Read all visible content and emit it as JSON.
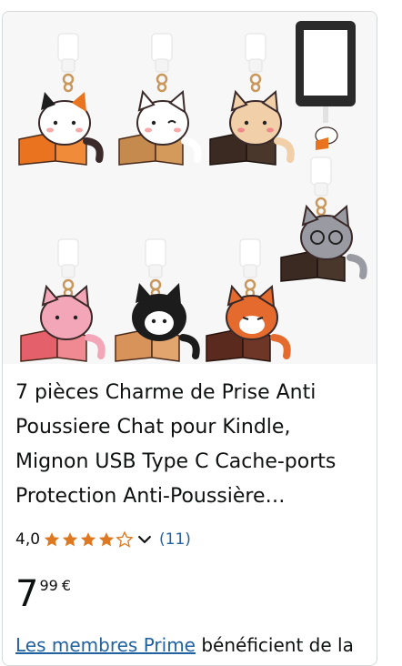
{
  "product": {
    "title": "7 pièces Charme de Prise Anti Poussiere Chat pour Kindle, Mignon USB Type C Cache-ports Protection Anti-Poussière…",
    "rating": "4,0",
    "stars_value": 4.0,
    "stars_max": 5,
    "review_count": "(11)",
    "price_whole": "7",
    "price_fraction": "99",
    "currency": "€",
    "prime_link": "Les membres Prime",
    "prime_rest": " bénéficient de la"
  },
  "icons": {
    "star": "star-icon",
    "chevron": "chevron-down-icon"
  },
  "colors": {
    "star": "#de7921",
    "link": "#2162a1",
    "text": "#0f1111"
  }
}
